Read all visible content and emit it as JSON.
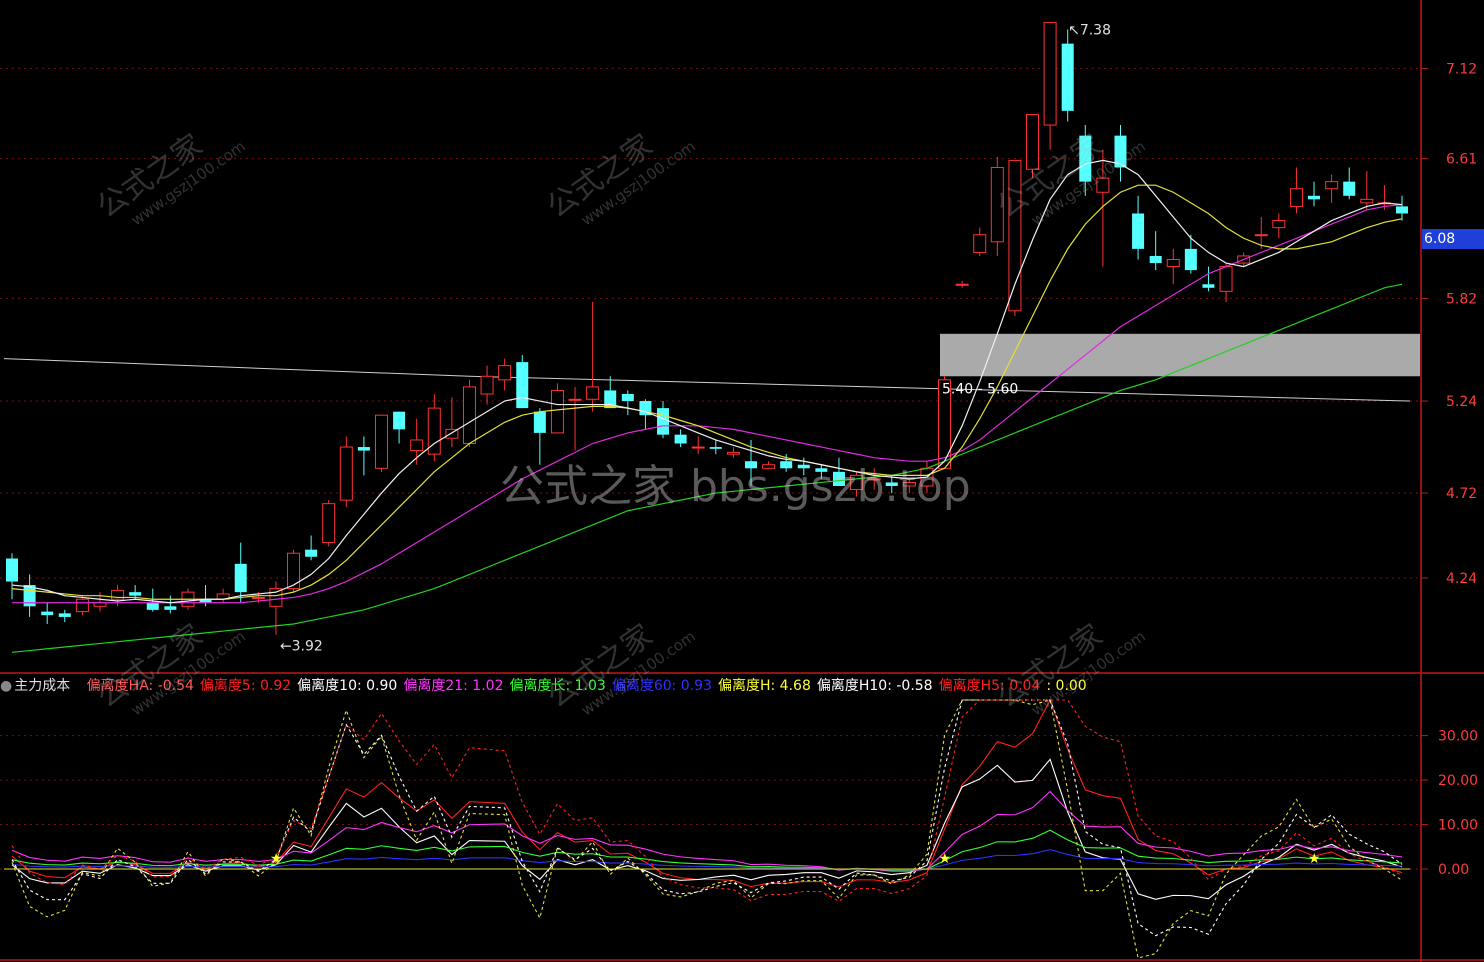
{
  "chart_data": [
    {
      "type": "candlestick",
      "panel": "price",
      "yticks": [
        "7.12",
        "6.61",
        "5.82",
        "5.24",
        "4.72",
        "4.24"
      ],
      "ylim": [
        3.72,
        7.45
      ],
      "grid": true,
      "candles_ohlc": [
        [
          4.35,
          4.38,
          4.12,
          4.22
        ],
        [
          4.2,
          4.26,
          4.02,
          4.08
        ],
        [
          4.05,
          4.1,
          3.98,
          4.03
        ],
        [
          4.04,
          4.06,
          3.99,
          4.02
        ],
        [
          4.05,
          4.14,
          4.03,
          4.12
        ],
        [
          4.08,
          4.16,
          4.05,
          4.1
        ],
        [
          4.12,
          4.2,
          4.08,
          4.17
        ],
        [
          4.16,
          4.2,
          4.12,
          4.14
        ],
        [
          4.1,
          4.18,
          4.05,
          4.06
        ],
        [
          4.08,
          4.14,
          4.04,
          4.06
        ],
        [
          4.08,
          4.18,
          4.06,
          4.16
        ],
        [
          4.12,
          4.2,
          4.08,
          4.1
        ],
        [
          4.12,
          4.18,
          4.1,
          4.15
        ],
        [
          4.32,
          4.44,
          4.1,
          4.16
        ],
        [
          4.13,
          4.16,
          4.1,
          4.13
        ],
        [
          4.08,
          4.22,
          3.92,
          4.18
        ],
        [
          4.18,
          4.4,
          4.16,
          4.38
        ],
        [
          4.4,
          4.48,
          4.34,
          4.36
        ],
        [
          4.44,
          4.68,
          4.42,
          4.66
        ],
        [
          4.68,
          5.04,
          4.64,
          4.98
        ],
        [
          4.98,
          5.04,
          4.82,
          4.96
        ],
        [
          4.86,
          5.16,
          4.84,
          5.16
        ],
        [
          5.18,
          5.18,
          5.0,
          5.08
        ],
        [
          4.96,
          5.14,
          4.88,
          5.02
        ],
        [
          4.94,
          5.28,
          4.9,
          5.2
        ],
        [
          5.03,
          5.26,
          4.98,
          5.08
        ],
        [
          5.0,
          5.36,
          4.98,
          5.32
        ],
        [
          5.28,
          5.44,
          5.22,
          5.38
        ],
        [
          5.36,
          5.48,
          5.3,
          5.44
        ],
        [
          5.46,
          5.5,
          5.2,
          5.2
        ],
        [
          5.18,
          5.2,
          4.88,
          5.06
        ],
        [
          5.06,
          5.34,
          5.06,
          5.3
        ],
        [
          5.25,
          5.32,
          4.96,
          5.25
        ],
        [
          5.25,
          5.8,
          5.18,
          5.32
        ],
        [
          5.3,
          5.38,
          5.2,
          5.2
        ],
        [
          5.28,
          5.3,
          5.16,
          5.24
        ],
        [
          5.24,
          5.25,
          5.08,
          5.16
        ],
        [
          5.2,
          5.24,
          5.03,
          5.05
        ],
        [
          5.05,
          5.08,
          4.98,
          5.0
        ],
        [
          4.98,
          5.04,
          4.94,
          4.98
        ],
        [
          4.98,
          5.02,
          4.94,
          4.97
        ],
        [
          4.94,
          4.98,
          4.92,
          4.95
        ],
        [
          4.9,
          5.02,
          4.76,
          4.86
        ],
        [
          4.86,
          4.9,
          4.86,
          4.88
        ],
        [
          4.9,
          4.94,
          4.84,
          4.86
        ],
        [
          4.88,
          4.92,
          4.82,
          4.86
        ],
        [
          4.86,
          4.88,
          4.8,
          4.84
        ],
        [
          4.84,
          4.92,
          4.8,
          4.76
        ],
        [
          4.74,
          4.84,
          4.7,
          4.82
        ],
        [
          4.8,
          4.86,
          4.74,
          4.8
        ],
        [
          4.78,
          4.82,
          4.72,
          4.76
        ],
        [
          4.76,
          4.8,
          4.72,
          4.78
        ],
        [
          4.76,
          4.9,
          4.72,
          4.86
        ],
        [
          4.86,
          5.38,
          4.86,
          5.36
        ],
        [
          5.9,
          5.92,
          5.88,
          5.9
        ],
        [
          6.08,
          6.22,
          6.06,
          6.18
        ],
        [
          6.14,
          6.62,
          6.06,
          6.56
        ],
        [
          5.75,
          6.6,
          5.72,
          6.6
        ],
        [
          6.55,
          6.86,
          6.5,
          6.86
        ],
        [
          6.8,
          7.38,
          6.66,
          7.38
        ],
        [
          7.26,
          7.34,
          6.82,
          6.88
        ],
        [
          6.74,
          6.8,
          6.4,
          6.48
        ],
        [
          6.42,
          6.66,
          6.0,
          6.5
        ],
        [
          6.74,
          6.8,
          6.48,
          6.56
        ],
        [
          6.3,
          6.4,
          6.04,
          6.1
        ],
        [
          6.06,
          6.2,
          5.98,
          6.02
        ],
        [
          6.0,
          6.1,
          5.9,
          6.04
        ],
        [
          6.1,
          6.18,
          5.96,
          5.98
        ],
        [
          5.9,
          6.0,
          5.86,
          5.88
        ],
        [
          5.86,
          6.02,
          5.8,
          6.0
        ],
        [
          6.02,
          6.08,
          6.0,
          6.06
        ],
        [
          6.18,
          6.28,
          6.1,
          6.18
        ],
        [
          6.22,
          6.3,
          6.16,
          6.26
        ],
        [
          6.34,
          6.56,
          6.3,
          6.44
        ],
        [
          6.4,
          6.48,
          6.34,
          6.38
        ],
        [
          6.44,
          6.52,
          6.36,
          6.48
        ],
        [
          6.48,
          6.56,
          6.38,
          6.4
        ],
        [
          6.36,
          6.54,
          6.32,
          6.38
        ],
        [
          6.36,
          6.46,
          6.32,
          6.36
        ],
        [
          6.34,
          6.4,
          6.26,
          6.3
        ]
      ],
      "ma_white": [
        4.2,
        4.19,
        4.17,
        4.14,
        4.13,
        4.12,
        4.11,
        4.12,
        4.11,
        4.1,
        4.11,
        4.12,
        4.12,
        4.14,
        4.15,
        4.16,
        4.2,
        4.26,
        4.35,
        4.48,
        4.6,
        4.72,
        4.83,
        4.92,
        5.0,
        5.06,
        5.12,
        5.18,
        5.24,
        5.26,
        5.24,
        5.22,
        5.22,
        5.22,
        5.22,
        5.2,
        5.18,
        5.14,
        5.1,
        5.06,
        5.02,
        4.99,
        4.96,
        4.93,
        4.91,
        4.9,
        4.88,
        4.86,
        4.84,
        4.82,
        4.81,
        4.8,
        4.81,
        4.9,
        5.1,
        5.35,
        5.62,
        5.9,
        6.15,
        6.38,
        6.52,
        6.58,
        6.6,
        6.58,
        6.52,
        6.4,
        6.28,
        6.16,
        6.08,
        6.02,
        6.0,
        6.04,
        6.08,
        6.14,
        6.2,
        6.26,
        6.3,
        6.34,
        6.36,
        6.35
      ],
      "ma_yellow": [
        4.18,
        4.17,
        4.16,
        4.15,
        4.14,
        4.14,
        4.13,
        4.13,
        4.12,
        4.12,
        4.12,
        4.12,
        4.12,
        4.13,
        4.14,
        4.14,
        4.16,
        4.2,
        4.26,
        4.34,
        4.44,
        4.54,
        4.64,
        4.74,
        4.84,
        4.92,
        5.0,
        5.06,
        5.12,
        5.16,
        5.18,
        5.19,
        5.2,
        5.21,
        5.21,
        5.2,
        5.18,
        5.16,
        5.13,
        5.1,
        5.06,
        5.02,
        4.98,
        4.95,
        4.92,
        4.9,
        4.88,
        4.86,
        4.84,
        4.83,
        4.82,
        4.82,
        4.82,
        4.86,
        4.98,
        5.14,
        5.32,
        5.52,
        5.72,
        5.92,
        6.1,
        6.24,
        6.34,
        6.42,
        6.46,
        6.46,
        6.42,
        6.36,
        6.3,
        6.22,
        6.16,
        6.12,
        6.1,
        6.1,
        6.12,
        6.14,
        6.18,
        6.22,
        6.25,
        6.27
      ],
      "ma_magenta": [
        4.1,
        4.1,
        4.1,
        4.1,
        4.1,
        4.1,
        4.1,
        4.1,
        4.1,
        4.1,
        4.1,
        4.1,
        4.1,
        4.1,
        4.11,
        4.12,
        4.13,
        4.15,
        4.18,
        4.22,
        4.27,
        4.32,
        4.38,
        4.44,
        4.5,
        4.56,
        4.62,
        4.68,
        4.74,
        4.8,
        4.85,
        4.9,
        4.95,
        5.0,
        5.03,
        5.06,
        5.08,
        5.1,
        5.1,
        5.1,
        5.09,
        5.08,
        5.06,
        5.04,
        5.02,
        5.0,
        4.98,
        4.96,
        4.94,
        4.92,
        4.91,
        4.9,
        4.9,
        4.92,
        4.96,
        5.02,
        5.1,
        5.18,
        5.26,
        5.34,
        5.42,
        5.5,
        5.58,
        5.66,
        5.72,
        5.78,
        5.84,
        5.9,
        5.96,
        6.0,
        6.04,
        6.08,
        6.12,
        6.16,
        6.2,
        6.24,
        6.28,
        6.32,
        6.34,
        6.35
      ],
      "ma_green": [
        3.82,
        3.83,
        3.84,
        3.85,
        3.86,
        3.87,
        3.88,
        3.89,
        3.9,
        3.91,
        3.92,
        3.93,
        3.94,
        3.95,
        3.96,
        3.97,
        3.98,
        4.0,
        4.02,
        4.04,
        4.06,
        4.09,
        4.12,
        4.15,
        4.18,
        4.22,
        4.26,
        4.3,
        4.34,
        4.38,
        4.42,
        4.46,
        4.5,
        4.54,
        4.58,
        4.62,
        4.64,
        4.66,
        4.68,
        4.7,
        4.72,
        4.73,
        4.74,
        4.75,
        4.76,
        4.77,
        4.78,
        4.79,
        4.8,
        4.81,
        4.82,
        4.84,
        4.86,
        4.9,
        4.94,
        4.98,
        5.02,
        5.06,
        5.1,
        5.14,
        5.18,
        5.22,
        5.26,
        5.3,
        5.33,
        5.36,
        5.4,
        5.44,
        5.48,
        5.52,
        5.56,
        5.6,
        5.64,
        5.68,
        5.72,
        5.76,
        5.8,
        5.84,
        5.88,
        5.9
      ],
      "annotations": {
        "high_label": "7.38",
        "low_label": "3.92",
        "zone_label": "5.40 - 5.60",
        "last_price": "6.08"
      }
    },
    {
      "type": "line",
      "panel": "indicator",
      "title": "主力成本",
      "yticks": [
        "30.00",
        "20.00",
        "10.00",
        "0.00"
      ],
      "ylim": [
        -20,
        38
      ],
      "series": [
        {
          "name": "偏离度HA",
          "value": "-0.54",
          "color": "#ff5a5a"
        },
        {
          "name": "偏离度5",
          "value": "0.92",
          "color": "#ff2020"
        },
        {
          "name": "偏离度10",
          "value": "0.90",
          "color": "#ffffff"
        },
        {
          "name": "偏离度21",
          "value": "1.02",
          "color": "#ff33ff"
        },
        {
          "name": "偏离度长",
          "value": "1.03",
          "color": "#33ff33"
        },
        {
          "name": "偏离度60",
          "value": "0.93",
          "color": "#3030ff"
        },
        {
          "name": "偏离度H",
          "value": "4.68",
          "color": "#ffff33"
        },
        {
          "name": "偏离度H10",
          "value": "-0.58",
          "color": "#ffffff"
        },
        {
          "name": "偏离度H5",
          "value": "0.04",
          "color": "#ff2020"
        },
        {
          "name": "",
          "value": "0.00",
          "color": "#ffff33"
        }
      ]
    }
  ],
  "watermarks": {
    "center": "公式之家 bbs.gszb.top",
    "diagonal_main": "公式之家",
    "diagonal_sub": "www.gszj100.com"
  }
}
